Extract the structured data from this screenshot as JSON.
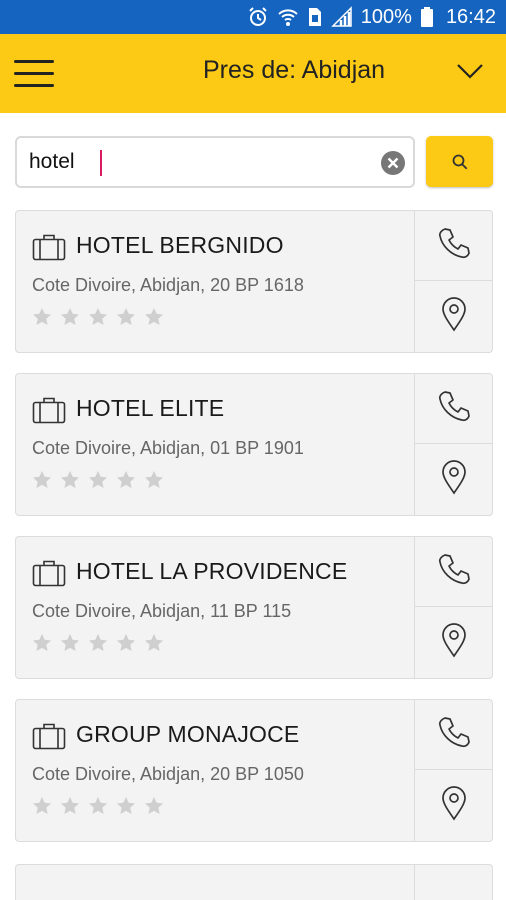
{
  "status_bar": {
    "battery": "100%",
    "time": "16:42",
    "icons": [
      "alarm-icon",
      "wifi-icon",
      "sim-icon",
      "signal-icon",
      "battery-icon"
    ]
  },
  "app_bar": {
    "location_label": "Pres de: Abidjan",
    "background_color": "#fcca14"
  },
  "search": {
    "value": "hotel",
    "button_icon": "search-icon"
  },
  "results": [
    {
      "name": "HOTEL BERGNIDO",
      "address": "Cote Divoire, Abidjan, 20 BP 1618",
      "rating": 0,
      "max_rating": 5
    },
    {
      "name": "HOTEL ELITE",
      "address": "Cote Divoire, Abidjan, 01 BP 1901",
      "rating": 0,
      "max_rating": 5
    },
    {
      "name": "HOTEL LA PROVIDENCE",
      "address": "Cote Divoire, Abidjan, 11 BP 115",
      "rating": 0,
      "max_rating": 5
    },
    {
      "name": "GROUP MONAJOCE",
      "address": "Cote Divoire, Abidjan, 20 BP 1050",
      "rating": 0,
      "max_rating": 5
    }
  ]
}
